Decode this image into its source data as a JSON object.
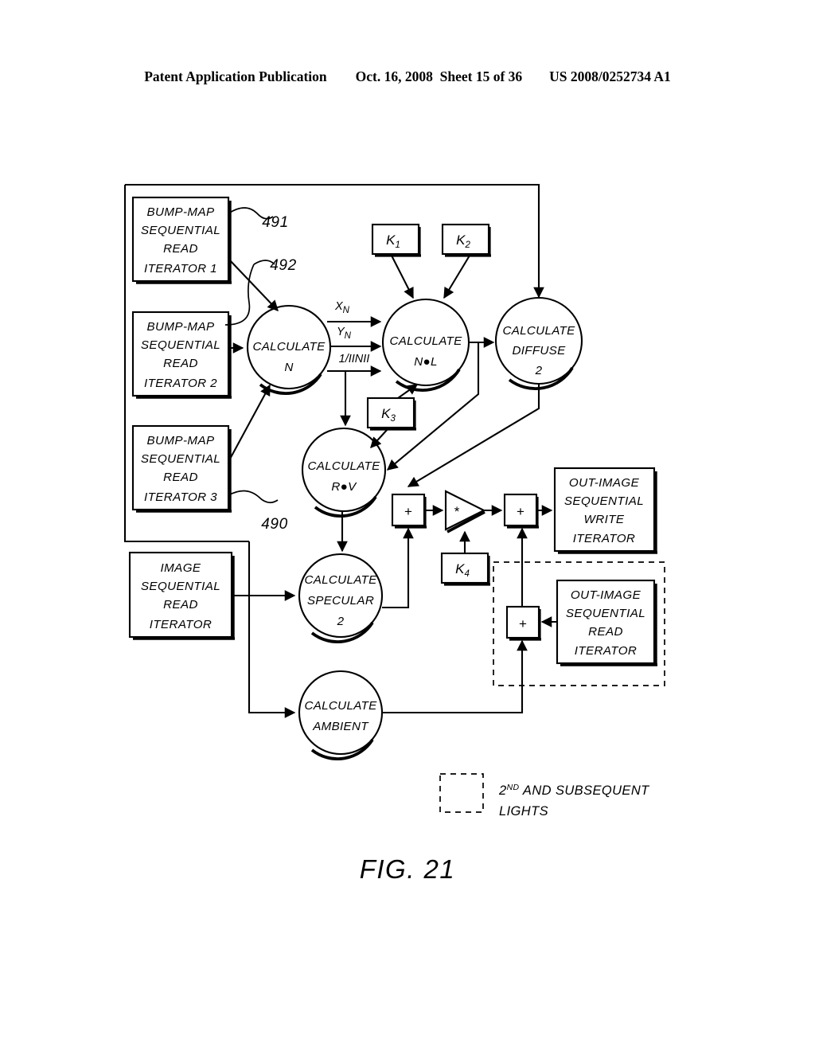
{
  "header": {
    "publication": "Patent Application Publication",
    "date_sheet": "Oct. 16, 2008  Sheet 15 of 36",
    "patent_number": "US 2008/0252734 A1"
  },
  "figure": {
    "caption": "FIG. 21"
  },
  "blocks": {
    "bump_map_1": "BUMP-MAP\nSEQUENTIAL\nREAD\nITERATOR 1",
    "bump_map_1_lines": [
      "BUMP-MAP",
      "SEQUENTIAL",
      "READ",
      "ITERATOR 1"
    ],
    "bump_map_2_lines": [
      "BUMP-MAP",
      "SEQUENTIAL",
      "READ",
      "ITERATOR 2"
    ],
    "bump_map_3_lines": [
      "BUMP-MAP",
      "SEQUENTIAL",
      "READ",
      "ITERATOR 3"
    ],
    "image_read_lines": [
      "IMAGE",
      "SEQUENTIAL",
      "READ",
      "ITERATOR"
    ],
    "out_write_lines": [
      "OUT-IMAGE",
      "SEQUENTIAL",
      "WRITE",
      "ITERATOR"
    ],
    "out_read_lines": [
      "OUT-IMAGE",
      "SEQUENTIAL",
      "READ",
      "ITERATOR"
    ]
  },
  "nodes": {
    "calc_n": [
      "CALCULATE",
      "N"
    ],
    "calc_ndotl": [
      "CALCULATE",
      "N●L"
    ],
    "calc_diffuse": [
      "CALCULATE",
      "DIFFUSE",
      "2"
    ],
    "calc_rdotv": [
      "CALCULATE",
      "R●V"
    ],
    "calc_specular": [
      "CALCULATE",
      "SPECULAR",
      "2"
    ],
    "calc_ambient": [
      "CALCULATE",
      "AMBIENT"
    ]
  },
  "constants": {
    "k1": {
      "base": "K",
      "sub": "1"
    },
    "k2": {
      "base": "K",
      "sub": "2"
    },
    "k3": {
      "base": "K",
      "sub": "3"
    },
    "k4": {
      "base": "K",
      "sub": "4"
    }
  },
  "signals": {
    "xn": {
      "base": "X",
      "sub": "N"
    },
    "yn": {
      "base": "Y",
      "sub": "N"
    },
    "inv_norm": "1/IINII"
  },
  "operators": {
    "add_1": "+",
    "multiply": "*",
    "add_2": "+",
    "add_3": "+"
  },
  "reference_numerals": {
    "n491": "491",
    "n492": "492",
    "n490": "490"
  },
  "legend": {
    "line1_prefix": "2",
    "line1_sup": "ND",
    "line1_rest": " AND SUBSEQUENT",
    "line2": "LIGHTS"
  },
  "colors": {
    "ink": "#000000",
    "paper": "#ffffff"
  }
}
